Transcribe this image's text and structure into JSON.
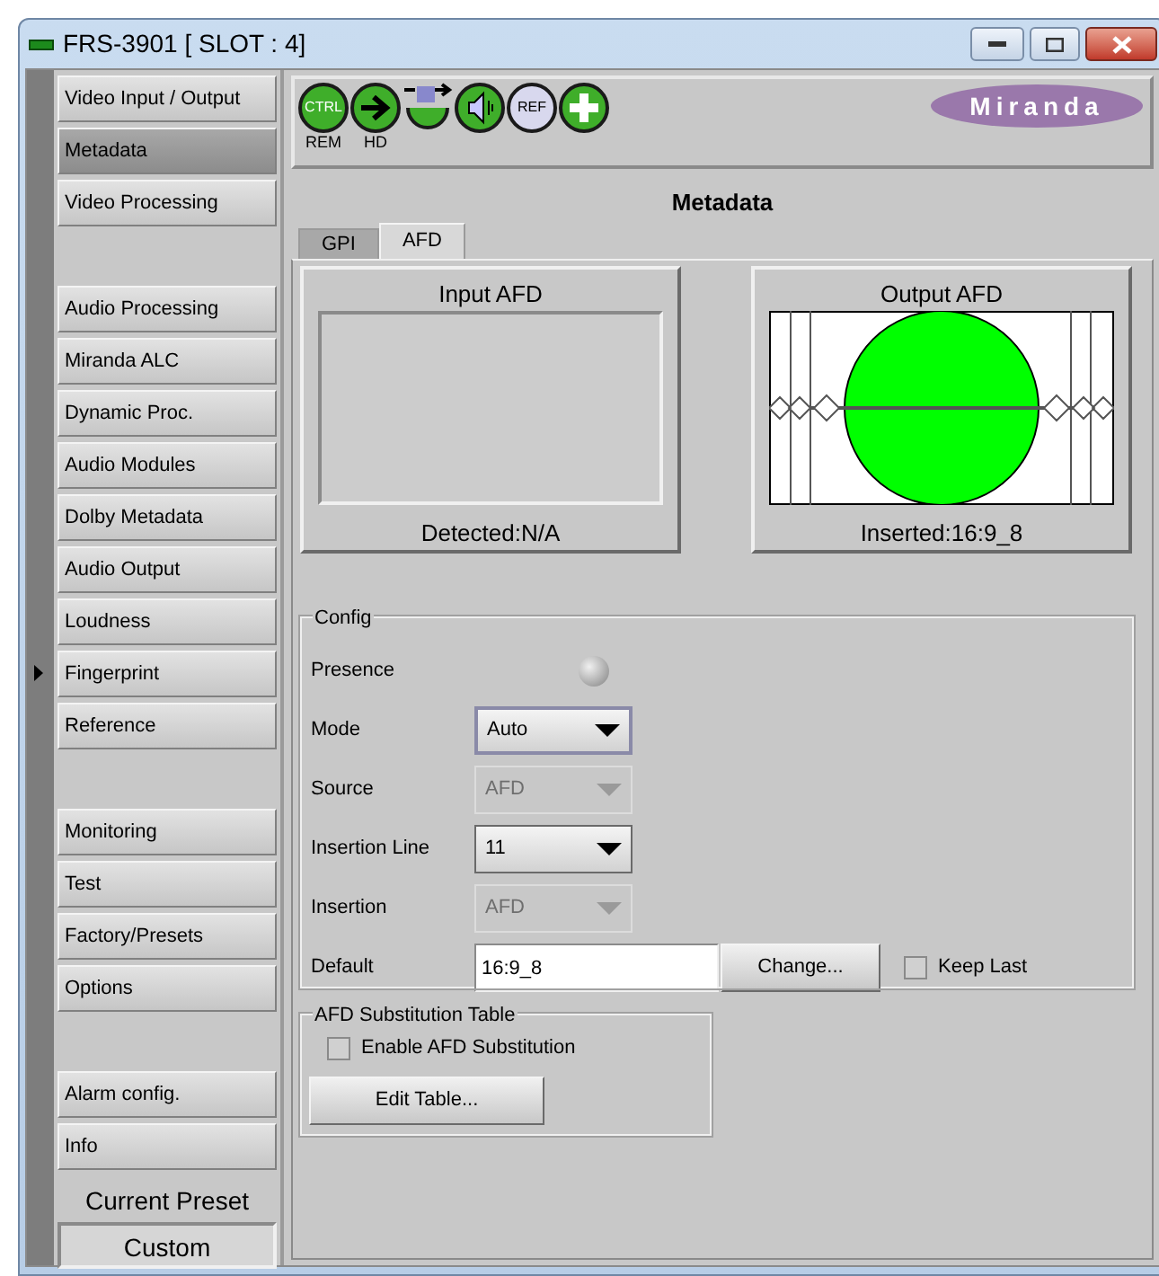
{
  "window": {
    "title": "FRS-3901 [ SLOT : 4]"
  },
  "sidebar": {
    "groups": [
      [
        {
          "label": "Video Input / Output",
          "selected": false,
          "pointer": false
        },
        {
          "label": "Metadata",
          "selected": true,
          "pointer": false
        },
        {
          "label": "Video Processing",
          "selected": false,
          "pointer": false
        }
      ],
      [
        {
          "label": "Audio Processing",
          "selected": false,
          "pointer": false
        },
        {
          "label": "Miranda ALC",
          "selected": false,
          "pointer": false
        },
        {
          "label": "Dynamic Proc.",
          "selected": false,
          "pointer": false
        },
        {
          "label": "Audio Modules",
          "selected": false,
          "pointer": false
        },
        {
          "label": "Dolby Metadata",
          "selected": false,
          "pointer": false
        },
        {
          "label": "Audio Output",
          "selected": false,
          "pointer": false
        },
        {
          "label": "Loudness",
          "selected": false,
          "pointer": false
        },
        {
          "label": "Fingerprint",
          "selected": false,
          "pointer": true
        },
        {
          "label": "Reference",
          "selected": false,
          "pointer": false
        }
      ],
      [
        {
          "label": "Monitoring",
          "selected": false,
          "pointer": false
        },
        {
          "label": "Test",
          "selected": false,
          "pointer": false
        },
        {
          "label": "Factory/Presets",
          "selected": false,
          "pointer": false
        },
        {
          "label": "Options",
          "selected": false,
          "pointer": false
        }
      ],
      [
        {
          "label": "Alarm config.",
          "selected": false,
          "pointer": false
        },
        {
          "label": "Info",
          "selected": false,
          "pointer": false
        }
      ]
    ],
    "preset_label": "Current Preset",
    "preset_value": "Custom"
  },
  "toolbar": {
    "icons": [
      {
        "kind": "ctrl",
        "text": "CTRL",
        "caption": "REM"
      },
      {
        "kind": "arrow",
        "caption": "HD"
      },
      {
        "kind": "input"
      },
      {
        "kind": "audio"
      },
      {
        "kind": "ref",
        "text": "REF"
      },
      {
        "kind": "plus"
      }
    ],
    "logo": "Miranda"
  },
  "panel_title": "Metadata",
  "tabs": [
    {
      "label": "GPI",
      "selected": false
    },
    {
      "label": "AFD",
      "selected": true
    }
  ],
  "afd_panels": [
    {
      "title": "Input AFD",
      "kind": "empty",
      "status": "Detected:N/A"
    },
    {
      "title": "Output AFD",
      "kind": "picture",
      "status": "Inserted:16:9_8"
    }
  ],
  "config": {
    "title": "Config",
    "rows": [
      {
        "kind": "led",
        "label": "Presence",
        "on": false
      },
      {
        "kind": "select",
        "label": "Mode",
        "value": "Auto",
        "disabled": false,
        "focused": true
      },
      {
        "kind": "select",
        "label": "Source",
        "value": "AFD",
        "disabled": true,
        "focused": false
      },
      {
        "kind": "select",
        "label": "Insertion Line",
        "value": "11",
        "disabled": false,
        "focused": false
      },
      {
        "kind": "select",
        "label": "Insertion",
        "value": "AFD",
        "disabled": true,
        "focused": false
      },
      {
        "kind": "default",
        "label": "Default",
        "value": "16:9_8",
        "button": "Change...",
        "checkbox": {
          "label": "Keep Last",
          "checked": false
        }
      }
    ]
  },
  "substitution": {
    "title": "AFD Substitution Table",
    "checkbox": {
      "label": "Enable AFD Substitution",
      "checked": false
    },
    "button": "Edit Table..."
  }
}
